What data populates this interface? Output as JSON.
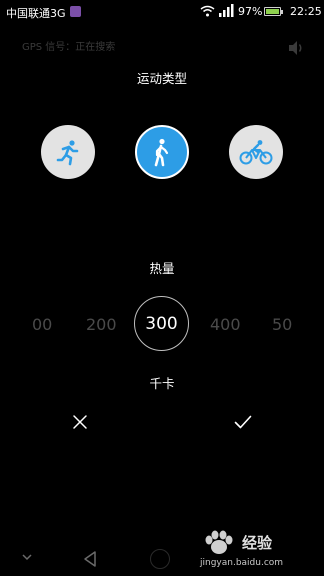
{
  "status_bar": {
    "carrier": "中国联通3G",
    "battery_percent": "97%",
    "battery_level": 0.97,
    "time": "22:25",
    "network_type": "3G"
  },
  "gps": {
    "status": "GPS 信号：正在搜索"
  },
  "sport_type": {
    "title": "运动类型",
    "options": [
      {
        "icon": "running-icon",
        "selected": false
      },
      {
        "icon": "walking-icon",
        "selected": true
      },
      {
        "icon": "cycling-icon",
        "selected": false
      }
    ]
  },
  "calories": {
    "title": "热量",
    "picker_values": [
      "00",
      "200",
      "300",
      "400",
      "50"
    ],
    "selected": "300",
    "unit": "千卡"
  },
  "actions": {
    "cancel_icon": "close-icon",
    "confirm_icon": "check-icon"
  },
  "watermark": {
    "text": "经验",
    "url": "jingyan.baidu.com"
  },
  "colors": {
    "accent": "#2d9de6",
    "background": "#000000",
    "option_bg": "#e3e3e3"
  }
}
